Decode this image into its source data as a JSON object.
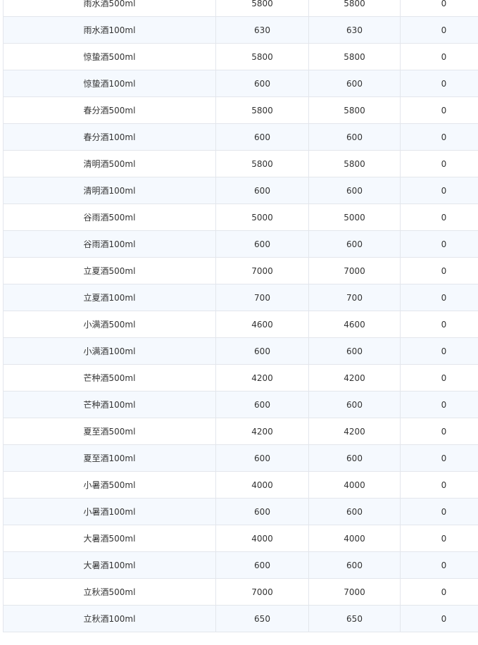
{
  "table": {
    "rows": [
      {
        "name": "雨水酒500ml",
        "col2": "5800",
        "col3": "5800",
        "col4": "0"
      },
      {
        "name": "雨水酒100ml",
        "col2": "630",
        "col3": "630",
        "col4": "0"
      },
      {
        "name": "惊蛰酒500ml",
        "col2": "5800",
        "col3": "5800",
        "col4": "0"
      },
      {
        "name": "惊蛰酒100ml",
        "col2": "600",
        "col3": "600",
        "col4": "0"
      },
      {
        "name": "春分酒500ml",
        "col2": "5800",
        "col3": "5800",
        "col4": "0"
      },
      {
        "name": "春分酒100ml",
        "col2": "600",
        "col3": "600",
        "col4": "0"
      },
      {
        "name": "清明酒500ml",
        "col2": "5800",
        "col3": "5800",
        "col4": "0"
      },
      {
        "name": "清明酒100ml",
        "col2": "600",
        "col3": "600",
        "col4": "0"
      },
      {
        "name": "谷雨酒500ml",
        "col2": "5000",
        "col3": "5000",
        "col4": "0"
      },
      {
        "name": "谷雨酒100ml",
        "col2": "600",
        "col3": "600",
        "col4": "0"
      },
      {
        "name": "立夏酒500ml",
        "col2": "7000",
        "col3": "7000",
        "col4": "0"
      },
      {
        "name": "立夏酒100ml",
        "col2": "700",
        "col3": "700",
        "col4": "0"
      },
      {
        "name": "小满酒500ml",
        "col2": "4600",
        "col3": "4600",
        "col4": "0"
      },
      {
        "name": "小满酒100ml",
        "col2": "600",
        "col3": "600",
        "col4": "0"
      },
      {
        "name": "芒种酒500ml",
        "col2": "4200",
        "col3": "4200",
        "col4": "0"
      },
      {
        "name": "芒种酒100ml",
        "col2": "600",
        "col3": "600",
        "col4": "0"
      },
      {
        "name": "夏至酒500ml",
        "col2": "4200",
        "col3": "4200",
        "col4": "0"
      },
      {
        "name": "夏至酒100ml",
        "col2": "600",
        "col3": "600",
        "col4": "0"
      },
      {
        "name": "小暑酒500ml",
        "col2": "4000",
        "col3": "4000",
        "col4": "0"
      },
      {
        "name": "小暑酒100ml",
        "col2": "600",
        "col3": "600",
        "col4": "0"
      },
      {
        "name": "大暑酒500ml",
        "col2": "4000",
        "col3": "4000",
        "col4": "0"
      },
      {
        "name": "大暑酒100ml",
        "col2": "600",
        "col3": "600",
        "col4": "0"
      },
      {
        "name": "立秋酒500ml",
        "col2": "7000",
        "col3": "7000",
        "col4": "0"
      },
      {
        "name": "立秋酒100ml",
        "col2": "650",
        "col3": "650",
        "col4": "0"
      }
    ]
  }
}
